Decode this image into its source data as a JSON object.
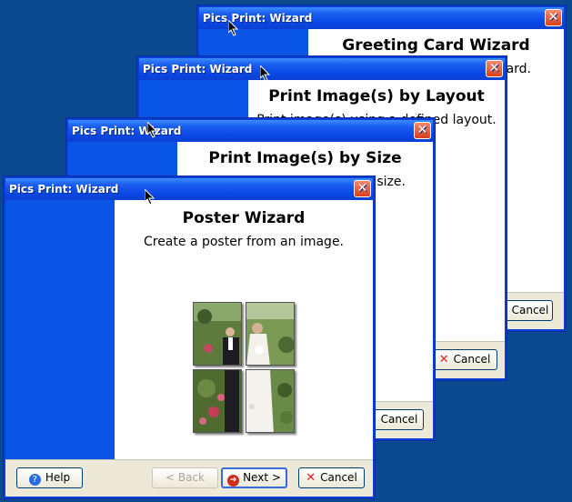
{
  "windows": [
    {
      "title": "Pics Print: Wizard",
      "heading": "Greeting Card Wizard",
      "description_visible": "ard.",
      "cancel_label": "Cancel"
    },
    {
      "title": "Pics Print: Wizard",
      "heading": "Print Image(s) by Layout",
      "description_visible": "Print image(s) using a defined layout.",
      "cancel_label": "Cancel"
    },
    {
      "title": "Pics Print: Wizard",
      "heading": "Print Image(s) by Size",
      "description_visible": "size.",
      "cancel_label": "Cancel"
    },
    {
      "title": "Pics Print: Wizard",
      "heading": "Poster Wizard",
      "description": "Create a poster from an image.",
      "buttons": {
        "help": "Help",
        "back": "< Back",
        "next": "Next >",
        "cancel": "Cancel"
      }
    }
  ],
  "icons": {
    "close": "close-icon",
    "help": "help-icon",
    "next": "next-arrow-icon",
    "cancel": "cancel-x-icon",
    "cursor": "mouse-cursor-icon"
  },
  "colors": {
    "desktop": "#0b4a8e",
    "titlebar": "#0a48e4",
    "sidebar": "#0b55e6",
    "footer": "#ece9d8"
  }
}
